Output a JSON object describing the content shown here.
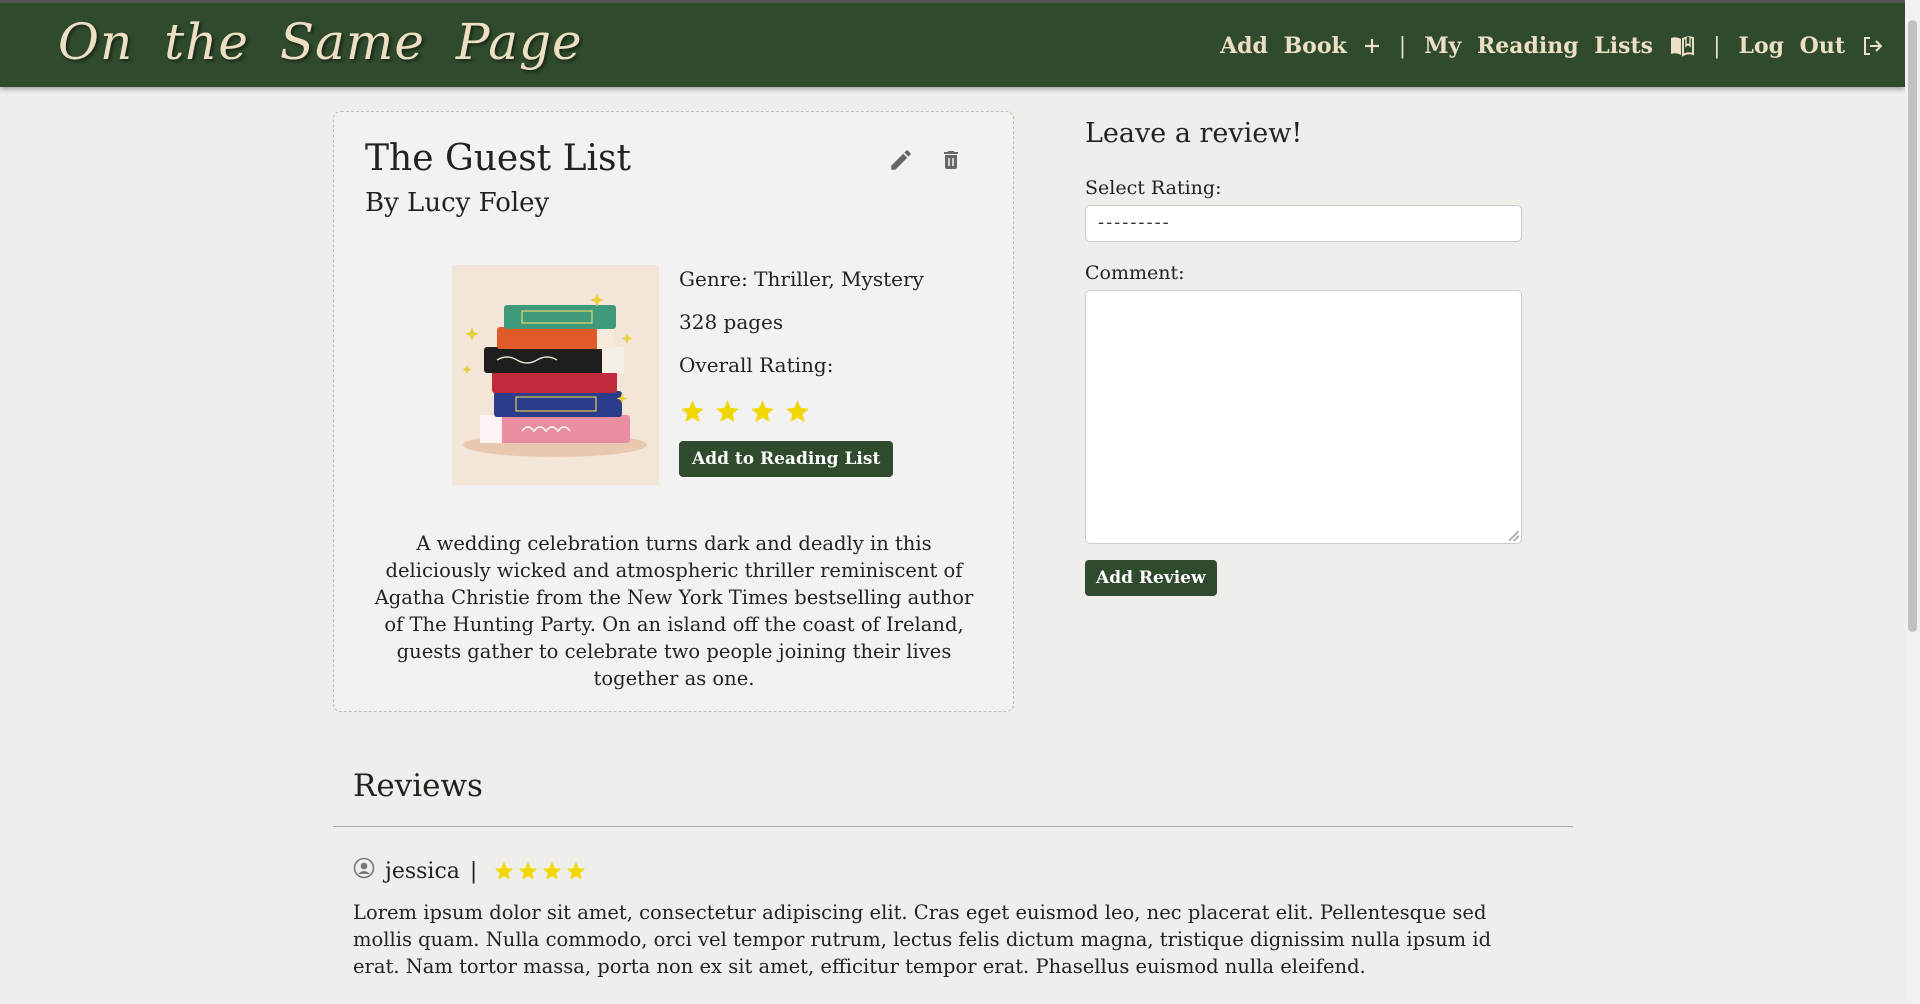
{
  "nav": {
    "brand": "On the Same Page",
    "add_book": "Add Book",
    "my_reading_lists": "My Reading Lists",
    "logout": "Log Out",
    "separator": "|"
  },
  "book": {
    "title": "The Guest List",
    "author": "By Lucy Foley",
    "genre": "Genre: Thriller, Mystery",
    "pages": "328 pages",
    "overall_rating_label": "Overall Rating:",
    "overall_rating": 4,
    "add_to_list": "Add to Reading List",
    "description": "A wedding celebration turns dark and deadly in this deliciously wicked and atmospheric thriller reminiscent of Agatha Christie from the New York Times bestselling author of The Hunting Party. On an island off the coast of Ireland, guests gather to celebrate two people joining their lives together as one."
  },
  "review_form": {
    "title": "Leave a review!",
    "rating_label": "Select Rating:",
    "rating_value": "---------",
    "comment_label": "Comment:",
    "comment_value": "",
    "submit": "Add Review"
  },
  "reviews": {
    "title": "Reviews",
    "items": [
      {
        "user": "jessica",
        "separator": "|",
        "rating": 4,
        "text": "Lorem ipsum dolor sit amet, consectetur adipiscing elit. Cras eget euismod leo, nec placerat elit. Pellentesque sed mollis quam. Nulla commodo, orci vel tempor rutrum, lectus felis dictum magna, tristique dignissim nulla ipsum id erat. Nam tortor massa, porta non ex sit amet, efficitur tempor erat. Phasellus euismod nulla eleifend."
      }
    ]
  },
  "colors": {
    "nav_bg": "#2f4a2c",
    "nav_text": "#ecdfc4",
    "star": "#f2d600",
    "button_bg": "#2f4a2c"
  },
  "icons": {
    "add_book": "plus-icon",
    "reading_lists": "book-open-icon",
    "logout": "logout-icon",
    "edit": "pencil-icon",
    "delete": "trash-icon",
    "user": "user-circle-icon",
    "star": "star-icon"
  }
}
